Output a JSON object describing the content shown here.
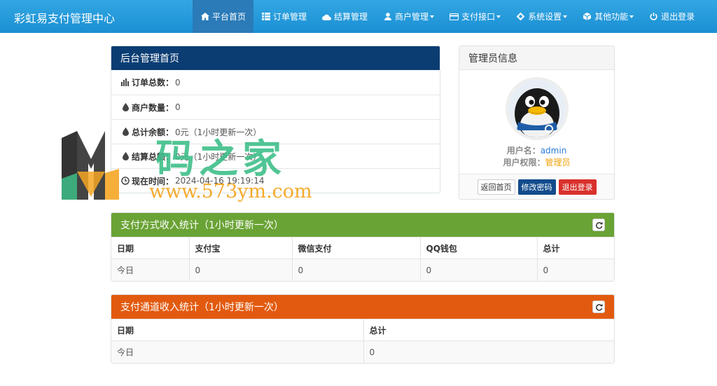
{
  "navbar": {
    "brand": "彩虹易支付管理中心",
    "items": [
      {
        "label": "平台首页",
        "icon": "home-icon",
        "active": true
      },
      {
        "label": "订单管理",
        "icon": "list-icon"
      },
      {
        "label": "结算管理",
        "icon": "cloud-icon"
      },
      {
        "label": "商户管理",
        "icon": "user-icon",
        "dropdown": true
      },
      {
        "label": "支付接口",
        "icon": "credit-card-icon",
        "dropdown": true
      },
      {
        "label": "系统设置",
        "icon": "gear-icon",
        "dropdown": true
      },
      {
        "label": "其他功能",
        "icon": "cube-icon",
        "dropdown": true
      },
      {
        "label": "退出登录",
        "icon": "power-icon"
      }
    ]
  },
  "overview": {
    "title": "后台管理首页",
    "rows": [
      {
        "label": "订单总数：",
        "value": "0"
      },
      {
        "label": "商户数量：",
        "value": "0"
      },
      {
        "label": "总计余额：",
        "value": "0元（1小时更新一次）"
      },
      {
        "label": "结算总额：",
        "value": "0元（1小时更新一次）"
      },
      {
        "label": "现在时间：",
        "value": "2024-04-16 19:19:14"
      }
    ]
  },
  "admin": {
    "title": "管理员信息",
    "username_label": "用户名：",
    "username": "admin",
    "role_label": "用户权限：",
    "role": "管理员",
    "buttons": {
      "home": "返回首页",
      "password": "修改密码",
      "logout": "退出登录"
    }
  },
  "pay_stats": {
    "title": "支付方式收入统计（1小时更新一次）",
    "headers": [
      "日期",
      "支付宝",
      "微信支付",
      "QQ钱包",
      "总计"
    ],
    "rows": [
      [
        "今日",
        "0",
        "0",
        "0",
        "0"
      ]
    ]
  },
  "channel_stats": {
    "title": "支付通道收入统计（1小时更新一次）",
    "headers": [
      "日期",
      "总计"
    ],
    "rows": [
      [
        "今日",
        "0"
      ]
    ]
  },
  "watermark": {
    "text": "码之家",
    "url": "www.573ym.com"
  },
  "colors": {
    "navbar": "#1a8fd3",
    "nav_active": "#2a7bb8",
    "overview_head": "#0b3d73",
    "pay_head": "#6aa335",
    "channel_head": "#e25a0f",
    "link": "#2a7bd6",
    "role": "#f0a30a",
    "btn_blue": "#124c8c",
    "btn_red": "#d9302c"
  }
}
